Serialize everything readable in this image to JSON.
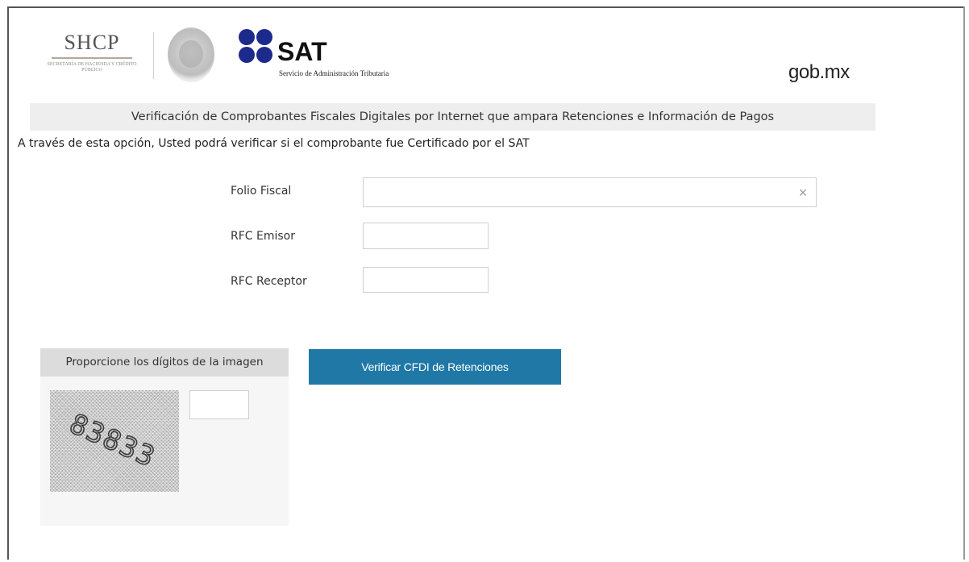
{
  "header": {
    "shcp_logo_text": "SHCP",
    "shcp_logo_subtext": "Secretaría de Hacienda y Crédito Público",
    "sat_logo_text": "SAT",
    "sat_logo_subtext": "Servicio de Administración Tributaria",
    "gob_text": "gob.mx"
  },
  "page": {
    "title": "Verificación de Comprobantes Fiscales Digitales por Internet que ampara Retenciones e Información de Pagos",
    "intro": "A través de esta opción, Usted podrá verificar si el comprobante fue Certificado por el SAT"
  },
  "form": {
    "folio_fiscal_label": "Folio Fiscal",
    "folio_fiscal_value": "",
    "rfc_emisor_label": "RFC Emisor",
    "rfc_emisor_value": "",
    "rfc_receptor_label": "RFC Receptor",
    "rfc_receptor_value": "",
    "clear_glyph": "×"
  },
  "captcha": {
    "header": "Proporcione los dígitos de la imagen",
    "digits": "83833",
    "input_value": ""
  },
  "actions": {
    "verify_label": "Verificar CFDI de Retenciones"
  },
  "colors": {
    "primary_button": "#1f78a6",
    "sat_logo_blue": "#1c2a8c",
    "title_band": "#eeeeee",
    "captcha_header": "#dcdcdc"
  },
  "icons": {
    "clear": "close-icon",
    "logo_dots": "sat-dots-icon"
  }
}
